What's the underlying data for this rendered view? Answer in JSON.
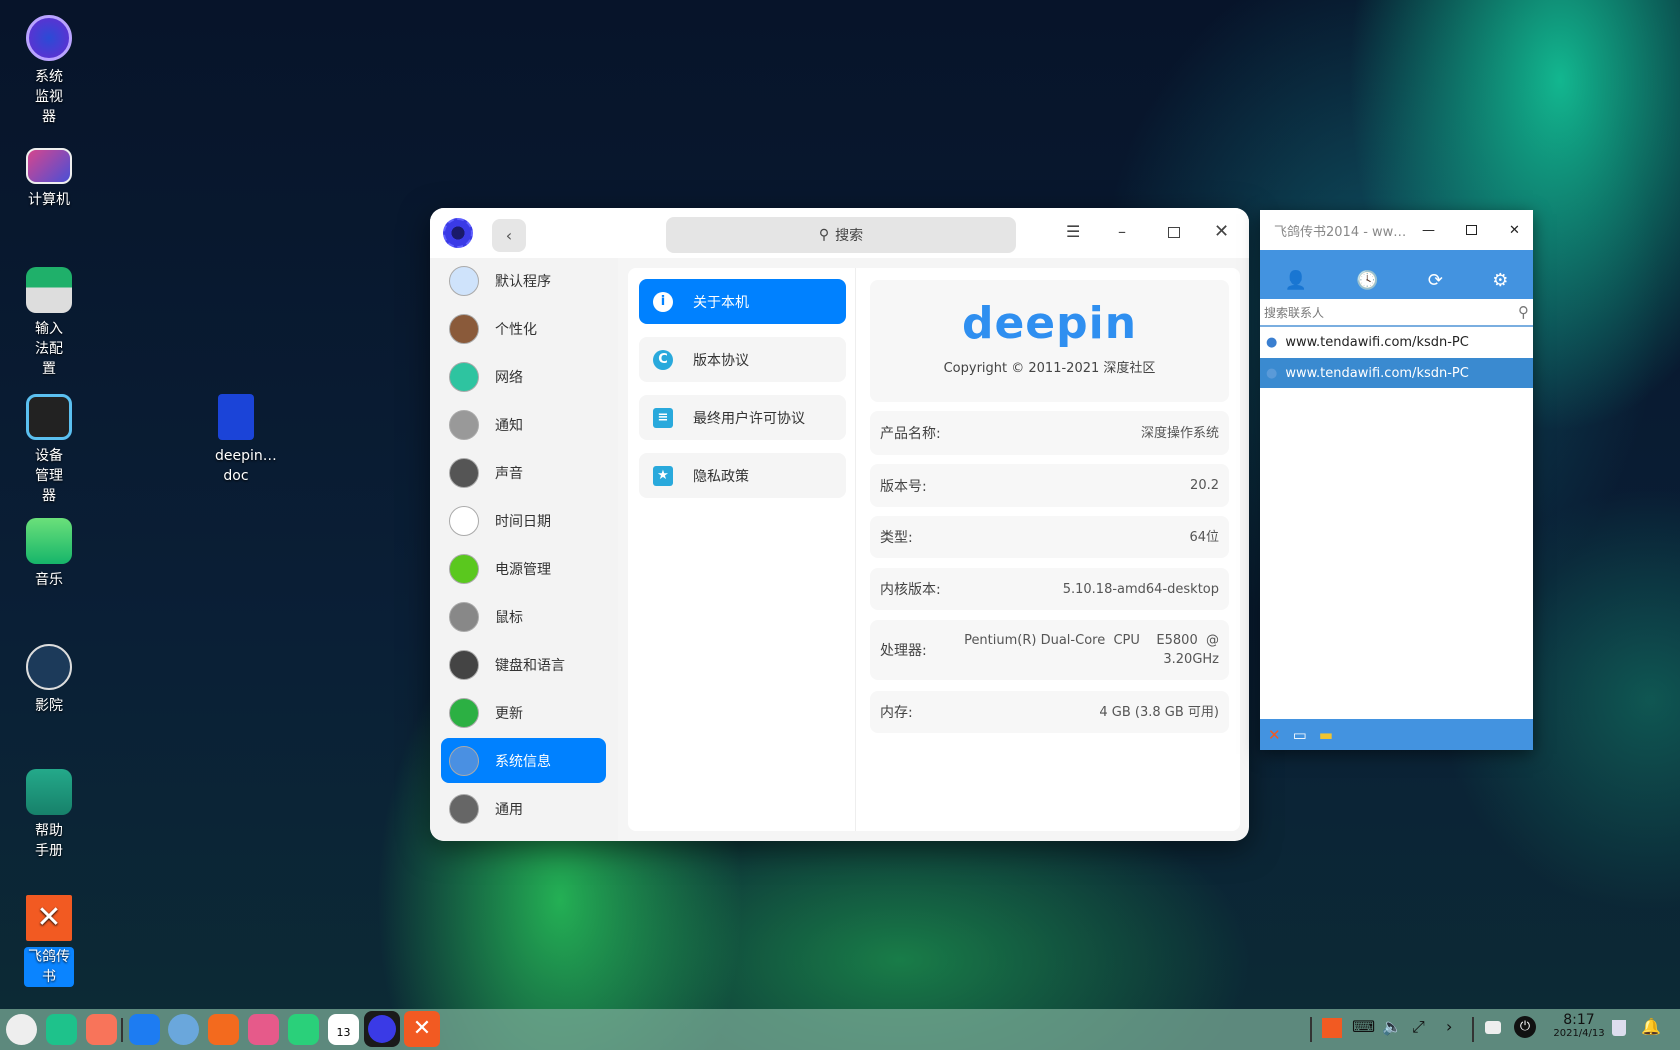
{
  "desktop": {
    "icons": [
      {
        "label": "系统监视器",
        "name": "system-monitor"
      },
      {
        "label": "计算机",
        "name": "computer"
      },
      {
        "label": "输入法配置",
        "name": "input-method-config"
      },
      {
        "label": "设备管理器",
        "name": "device-manager"
      },
      {
        "label": "音乐",
        "name": "music"
      },
      {
        "label": "影院",
        "name": "movie"
      },
      {
        "label": "帮助手册",
        "name": "manual"
      },
      {
        "label": "飞鸽传书",
        "name": "feige"
      }
    ],
    "file": {
      "label": "deepin…doc"
    }
  },
  "control_center": {
    "search_placeholder": "搜索",
    "sidebar": [
      "默认程序",
      "个性化",
      "网络",
      "通知",
      "声音",
      "时间日期",
      "电源管理",
      "鼠标",
      "键盘和语言",
      "更新",
      "系统信息",
      "通用"
    ],
    "menu": [
      "关于本机",
      "版本协议",
      "最终用户许可协议",
      "隐私政策"
    ],
    "logo": "deepin",
    "copyright": "Copyright © 2011-2021 深度社区",
    "info": [
      {
        "label": "产品名称:",
        "value": "深度操作系统"
      },
      {
        "label": "版本号:",
        "value": "20.2"
      },
      {
        "label": "类型:",
        "value": "64位"
      },
      {
        "label": "内核版本:",
        "value": "5.10.18-amd64-desktop"
      },
      {
        "label": "处理器:",
        "value": "Pentium(R) Dual-Core  CPU    E5800  @",
        "value2": "3.20GHz"
      },
      {
        "label": "内存:",
        "value": "4 GB (3.8 GB 可用)"
      }
    ]
  },
  "feige": {
    "title": "飞鸽传书2014 - ww…",
    "search_placeholder": "搜索联系人",
    "contacts": [
      "www.tendawifi.com/ksdn-PC",
      "www.tendawifi.com/ksdn-PC"
    ]
  },
  "taskbar": {
    "time": "8:17",
    "date": "2021/4/13",
    "calendar_day": "13"
  },
  "colors": {
    "accent": "#0081ff",
    "feige_blue": "#4393e0"
  }
}
